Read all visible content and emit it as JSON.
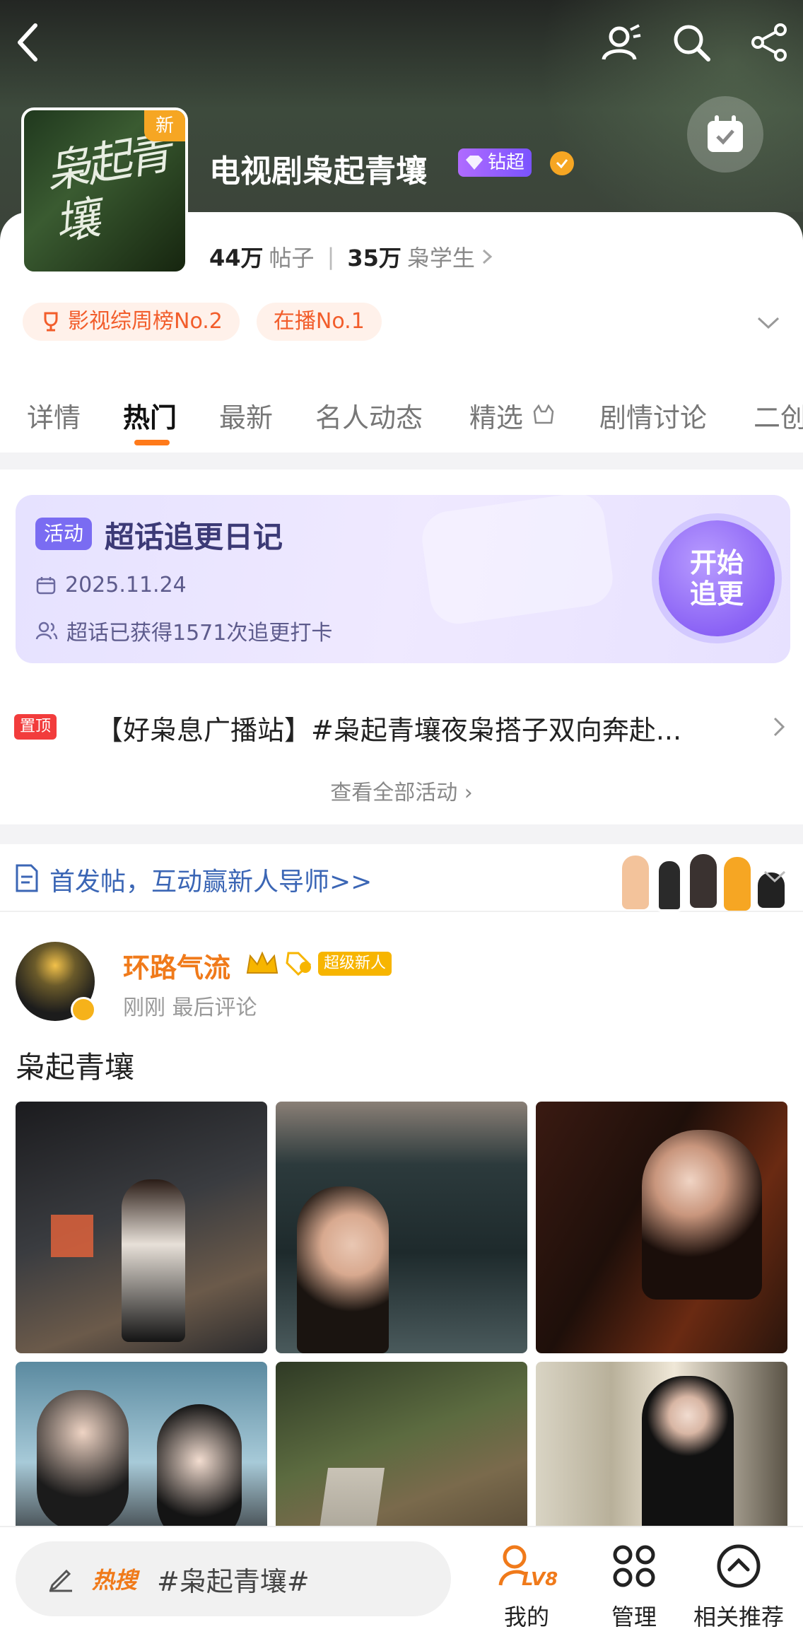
{
  "header": {
    "title": "电视剧枭起青壤",
    "cover_text": "枭起青壤",
    "new_tag": "新",
    "badge_label": "钻超",
    "stats": {
      "posts_value": "44万",
      "posts_label": "帖子",
      "fans_value": "35万",
      "fans_label": "枭学生"
    },
    "ranks": [
      "影视综周榜No.2",
      "在播No.1"
    ]
  },
  "tabs": [
    "详情",
    "热门",
    "最新",
    "名人动态",
    "精选",
    "剧情讨论",
    "二创"
  ],
  "active_tab": "热门",
  "activity": {
    "tag": "活动",
    "title": "超话追更日记",
    "date": "2025.11.24",
    "count_text": "超话已获得1571次追更打卡",
    "button_line1": "开始",
    "button_line2": "追更"
  },
  "pinned": {
    "tag": "置顶",
    "text": "【好枭息广播站】#枭起青壤夜枭搭子双向奔赴..."
  },
  "see_all": "查看全部活动 ›",
  "newbie_banner": "首发帖，互动赢新人导师>>",
  "post": {
    "username": "环路气流",
    "super_badge": "超级新人",
    "time": "刚刚 最后评论",
    "text": "枭起青壤"
  },
  "bottom": {
    "hot_label": "热搜",
    "keyword": "#枭起青壤#",
    "nav": [
      {
        "label": "我的",
        "icon": "lv8-icon",
        "level": "LV8"
      },
      {
        "label": "管理",
        "icon": "grid-icon"
      },
      {
        "label": "相关推荐",
        "icon": "up-circle-icon"
      }
    ]
  },
  "colors": {
    "accent": "#f07a1a",
    "activity_purple": "#7a6cf2",
    "pin_red": "#f23c3c"
  }
}
